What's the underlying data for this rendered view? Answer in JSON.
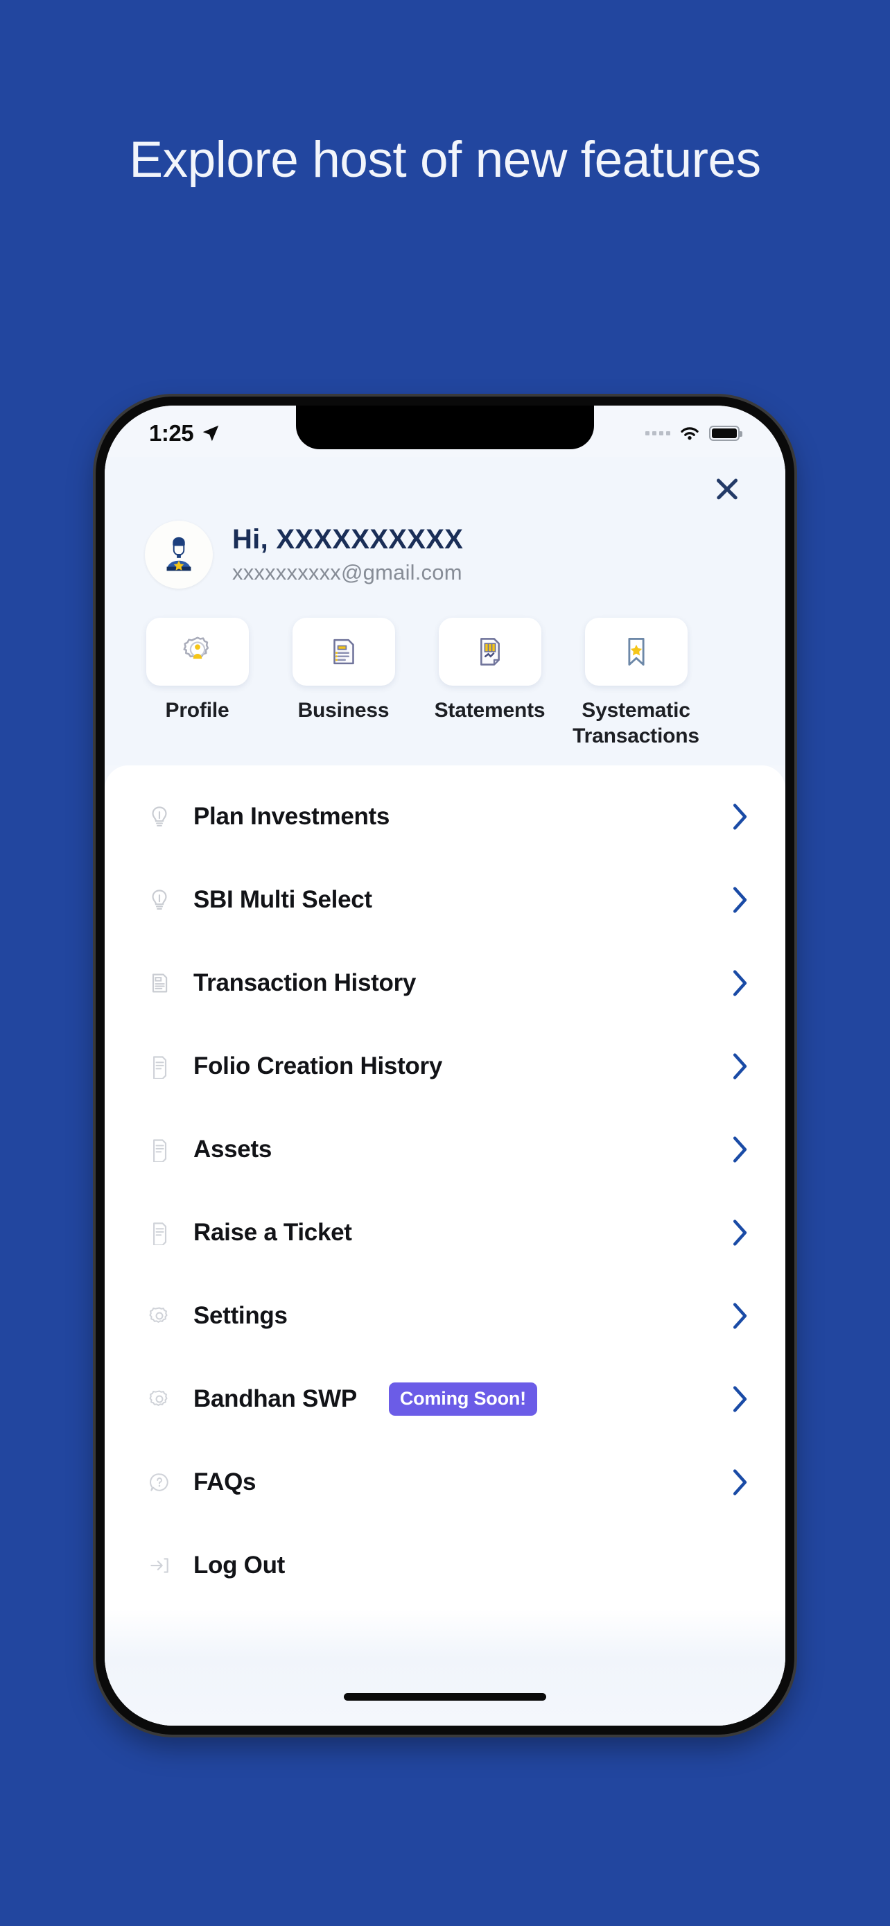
{
  "promo": {
    "headline": "Explore host of new features"
  },
  "theme": {
    "background": "#22469f",
    "accent": "#1a4ba6",
    "badge": "#6b5ce7",
    "panel": "#f2f6fc"
  },
  "statusbar": {
    "time": "1:25",
    "location_icon": "location-arrow-icon",
    "signal_icon": "signal-dots-icon",
    "wifi_icon": "wifi-icon",
    "battery_icon": "battery-full-icon"
  },
  "header": {
    "close_label": "close-icon",
    "avatar_icon": "user-avatar-star-icon",
    "greeting": "Hi, XXXXXXXXXX",
    "email": "xxxxxxxxxx@gmail.com"
  },
  "tiles": [
    {
      "label": "Profile",
      "icon": "profile-gear-person-icon"
    },
    {
      "label": "Business",
      "icon": "business-document-icon"
    },
    {
      "label": "Statements",
      "icon": "statements-chart-doc-icon"
    },
    {
      "label": "Systematic Transactions",
      "icon": "bookmark-star-icon"
    }
  ],
  "menu": {
    "items": [
      {
        "label": "Plan Investments",
        "icon": "bulb-icon",
        "badge": null,
        "chevron": true
      },
      {
        "label": "SBI Multi Select",
        "icon": "bulb-icon",
        "badge": null,
        "chevron": true
      },
      {
        "label": "Transaction History",
        "icon": "receipt-icon",
        "badge": null,
        "chevron": true
      },
      {
        "label": "Folio Creation History",
        "icon": "document-icon",
        "badge": null,
        "chevron": true
      },
      {
        "label": "Assets",
        "icon": "document-icon",
        "badge": null,
        "chevron": true
      },
      {
        "label": "Raise a Ticket",
        "icon": "document-icon",
        "badge": null,
        "chevron": true
      },
      {
        "label": "Settings",
        "icon": "gear-icon",
        "badge": null,
        "chevron": true
      },
      {
        "label": "Bandhan SWP",
        "icon": "gear-icon",
        "badge": "Coming Soon!",
        "chevron": true
      },
      {
        "label": "FAQs",
        "icon": "question-bubble-icon",
        "badge": null,
        "chevron": true
      },
      {
        "label": "Log Out",
        "icon": "logout-icon",
        "badge": null,
        "chevron": false
      }
    ]
  }
}
